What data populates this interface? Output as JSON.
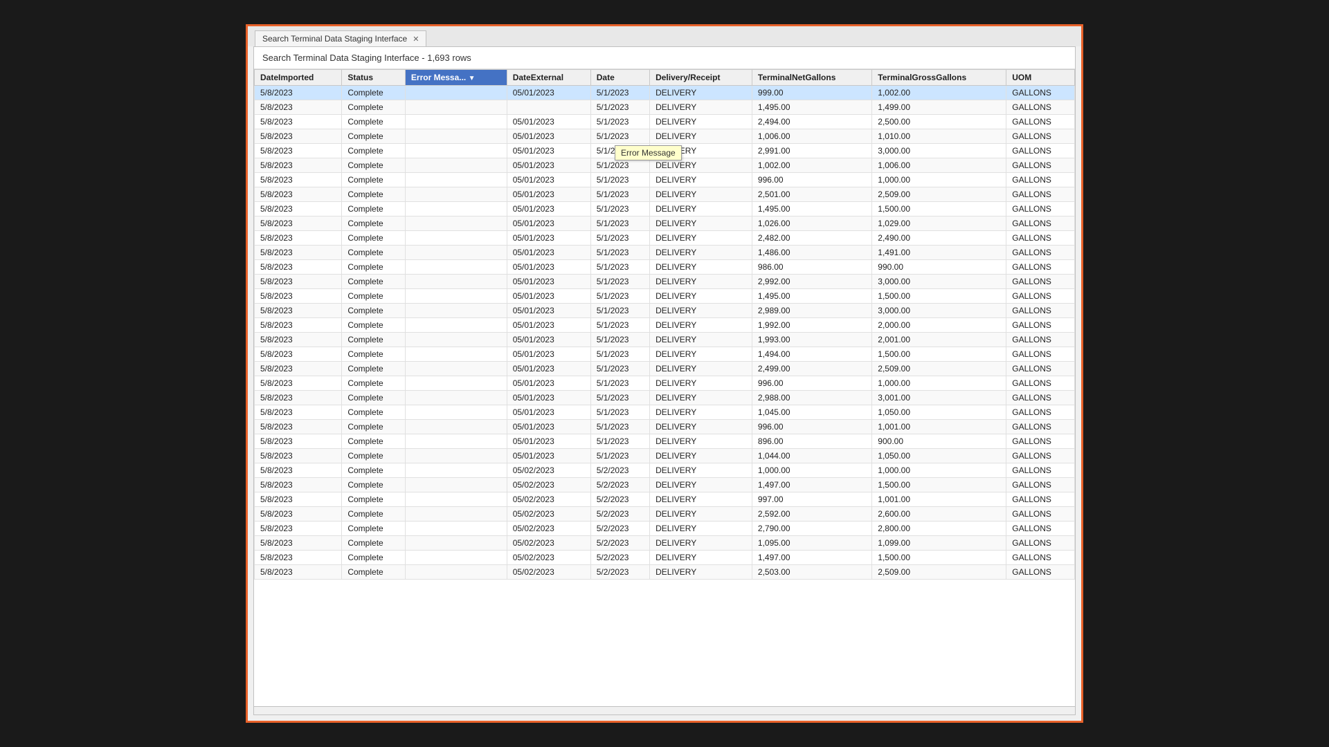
{
  "window": {
    "tab_label": "Search Terminal Data Staging Interface",
    "title": "Search Terminal Data Staging Interface - 1,693 rows",
    "tooltip": "Error Message"
  },
  "columns": [
    {
      "key": "dateImported",
      "label": "DateImported",
      "filter": false
    },
    {
      "key": "status",
      "label": "Status",
      "filter": false
    },
    {
      "key": "errorMessage",
      "label": "Error Messa...",
      "filter": true
    },
    {
      "key": "dateExternal",
      "label": "DateExternal",
      "filter": false
    },
    {
      "key": "date",
      "label": "Date",
      "filter": false
    },
    {
      "key": "deliveryReceipt",
      "label": "Delivery/Receipt",
      "filter": false
    },
    {
      "key": "terminalNetGallons",
      "label": "TerminalNetGallons",
      "filter": false
    },
    {
      "key": "terminalGrossGallons",
      "label": "TerminalGrossGallons",
      "filter": false
    },
    {
      "key": "uom",
      "label": "UOM",
      "filter": false
    }
  ],
  "rows": [
    {
      "dateImported": "5/8/2023",
      "status": "Complete",
      "errorMessage": "",
      "dateExternal": "05/01/2023",
      "date": "5/1/2023",
      "deliveryReceipt": "DELIVERY",
      "terminalNetGallons": "999.00",
      "terminalGrossGallons": "1,002.00",
      "uom": "GALLONS",
      "selected": true
    },
    {
      "dateImported": "5/8/2023",
      "status": "Complete",
      "errorMessage": "",
      "dateExternal": "",
      "date": "5/1/2023",
      "deliveryReceipt": "DELIVERY",
      "terminalNetGallons": "1,495.00",
      "terminalGrossGallons": "1,499.00",
      "uom": "GALLONS",
      "selected": false
    },
    {
      "dateImported": "5/8/2023",
      "status": "Complete",
      "errorMessage": "",
      "dateExternal": "05/01/2023",
      "date": "5/1/2023",
      "deliveryReceipt": "DELIVERY",
      "terminalNetGallons": "2,494.00",
      "terminalGrossGallons": "2,500.00",
      "uom": "GALLONS",
      "selected": false
    },
    {
      "dateImported": "5/8/2023",
      "status": "Complete",
      "errorMessage": "",
      "dateExternal": "05/01/2023",
      "date": "5/1/2023",
      "deliveryReceipt": "DELIVERY",
      "terminalNetGallons": "1,006.00",
      "terminalGrossGallons": "1,010.00",
      "uom": "GALLONS",
      "selected": false
    },
    {
      "dateImported": "5/8/2023",
      "status": "Complete",
      "errorMessage": "",
      "dateExternal": "05/01/2023",
      "date": "5/1/2023",
      "deliveryReceipt": "DELIVERY",
      "terminalNetGallons": "2,991.00",
      "terminalGrossGallons": "3,000.00",
      "uom": "GALLONS",
      "selected": false
    },
    {
      "dateImported": "5/8/2023",
      "status": "Complete",
      "errorMessage": "",
      "dateExternal": "05/01/2023",
      "date": "5/1/2023",
      "deliveryReceipt": "DELIVERY",
      "terminalNetGallons": "1,002.00",
      "terminalGrossGallons": "1,006.00",
      "uom": "GALLONS",
      "selected": false
    },
    {
      "dateImported": "5/8/2023",
      "status": "Complete",
      "errorMessage": "",
      "dateExternal": "05/01/2023",
      "date": "5/1/2023",
      "deliveryReceipt": "DELIVERY",
      "terminalNetGallons": "996.00",
      "terminalGrossGallons": "1,000.00",
      "uom": "GALLONS",
      "selected": false
    },
    {
      "dateImported": "5/8/2023",
      "status": "Complete",
      "errorMessage": "",
      "dateExternal": "05/01/2023",
      "date": "5/1/2023",
      "deliveryReceipt": "DELIVERY",
      "terminalNetGallons": "2,501.00",
      "terminalGrossGallons": "2,509.00",
      "uom": "GALLONS",
      "selected": false
    },
    {
      "dateImported": "5/8/2023",
      "status": "Complete",
      "errorMessage": "",
      "dateExternal": "05/01/2023",
      "date": "5/1/2023",
      "deliveryReceipt": "DELIVERY",
      "terminalNetGallons": "1,495.00",
      "terminalGrossGallons": "1,500.00",
      "uom": "GALLONS",
      "selected": false
    },
    {
      "dateImported": "5/8/2023",
      "status": "Complete",
      "errorMessage": "",
      "dateExternal": "05/01/2023",
      "date": "5/1/2023",
      "deliveryReceipt": "DELIVERY",
      "terminalNetGallons": "1,026.00",
      "terminalGrossGallons": "1,029.00",
      "uom": "GALLONS",
      "selected": false
    },
    {
      "dateImported": "5/8/2023",
      "status": "Complete",
      "errorMessage": "",
      "dateExternal": "05/01/2023",
      "date": "5/1/2023",
      "deliveryReceipt": "DELIVERY",
      "terminalNetGallons": "2,482.00",
      "terminalGrossGallons": "2,490.00",
      "uom": "GALLONS",
      "selected": false
    },
    {
      "dateImported": "5/8/2023",
      "status": "Complete",
      "errorMessage": "",
      "dateExternal": "05/01/2023",
      "date": "5/1/2023",
      "deliveryReceipt": "DELIVERY",
      "terminalNetGallons": "1,486.00",
      "terminalGrossGallons": "1,491.00",
      "uom": "GALLONS",
      "selected": false
    },
    {
      "dateImported": "5/8/2023",
      "status": "Complete",
      "errorMessage": "",
      "dateExternal": "05/01/2023",
      "date": "5/1/2023",
      "deliveryReceipt": "DELIVERY",
      "terminalNetGallons": "986.00",
      "terminalGrossGallons": "990.00",
      "uom": "GALLONS",
      "selected": false
    },
    {
      "dateImported": "5/8/2023",
      "status": "Complete",
      "errorMessage": "",
      "dateExternal": "05/01/2023",
      "date": "5/1/2023",
      "deliveryReceipt": "DELIVERY",
      "terminalNetGallons": "2,992.00",
      "terminalGrossGallons": "3,000.00",
      "uom": "GALLONS",
      "selected": false
    },
    {
      "dateImported": "5/8/2023",
      "status": "Complete",
      "errorMessage": "",
      "dateExternal": "05/01/2023",
      "date": "5/1/2023",
      "deliveryReceipt": "DELIVERY",
      "terminalNetGallons": "1,495.00",
      "terminalGrossGallons": "1,500.00",
      "uom": "GALLONS",
      "selected": false
    },
    {
      "dateImported": "5/8/2023",
      "status": "Complete",
      "errorMessage": "",
      "dateExternal": "05/01/2023",
      "date": "5/1/2023",
      "deliveryReceipt": "DELIVERY",
      "terminalNetGallons": "2,989.00",
      "terminalGrossGallons": "3,000.00",
      "uom": "GALLONS",
      "selected": false
    },
    {
      "dateImported": "5/8/2023",
      "status": "Complete",
      "errorMessage": "",
      "dateExternal": "05/01/2023",
      "date": "5/1/2023",
      "deliveryReceipt": "DELIVERY",
      "terminalNetGallons": "1,992.00",
      "terminalGrossGallons": "2,000.00",
      "uom": "GALLONS",
      "selected": false
    },
    {
      "dateImported": "5/8/2023",
      "status": "Complete",
      "errorMessage": "",
      "dateExternal": "05/01/2023",
      "date": "5/1/2023",
      "deliveryReceipt": "DELIVERY",
      "terminalNetGallons": "1,993.00",
      "terminalGrossGallons": "2,001.00",
      "uom": "GALLONS",
      "selected": false
    },
    {
      "dateImported": "5/8/2023",
      "status": "Complete",
      "errorMessage": "",
      "dateExternal": "05/01/2023",
      "date": "5/1/2023",
      "deliveryReceipt": "DELIVERY",
      "terminalNetGallons": "1,494.00",
      "terminalGrossGallons": "1,500.00",
      "uom": "GALLONS",
      "selected": false
    },
    {
      "dateImported": "5/8/2023",
      "status": "Complete",
      "errorMessage": "",
      "dateExternal": "05/01/2023",
      "date": "5/1/2023",
      "deliveryReceipt": "DELIVERY",
      "terminalNetGallons": "2,499.00",
      "terminalGrossGallons": "2,509.00",
      "uom": "GALLONS",
      "selected": false
    },
    {
      "dateImported": "5/8/2023",
      "status": "Complete",
      "errorMessage": "",
      "dateExternal": "05/01/2023",
      "date": "5/1/2023",
      "deliveryReceipt": "DELIVERY",
      "terminalNetGallons": "996.00",
      "terminalGrossGallons": "1,000.00",
      "uom": "GALLONS",
      "selected": false
    },
    {
      "dateImported": "5/8/2023",
      "status": "Complete",
      "errorMessage": "",
      "dateExternal": "05/01/2023",
      "date": "5/1/2023",
      "deliveryReceipt": "DELIVERY",
      "terminalNetGallons": "2,988.00",
      "terminalGrossGallons": "3,001.00",
      "uom": "GALLONS",
      "selected": false
    },
    {
      "dateImported": "5/8/2023",
      "status": "Complete",
      "errorMessage": "",
      "dateExternal": "05/01/2023",
      "date": "5/1/2023",
      "deliveryReceipt": "DELIVERY",
      "terminalNetGallons": "1,045.00",
      "terminalGrossGallons": "1,050.00",
      "uom": "GALLONS",
      "selected": false
    },
    {
      "dateImported": "5/8/2023",
      "status": "Complete",
      "errorMessage": "",
      "dateExternal": "05/01/2023",
      "date": "5/1/2023",
      "deliveryReceipt": "DELIVERY",
      "terminalNetGallons": "996.00",
      "terminalGrossGallons": "1,001.00",
      "uom": "GALLONS",
      "selected": false
    },
    {
      "dateImported": "5/8/2023",
      "status": "Complete",
      "errorMessage": "",
      "dateExternal": "05/01/2023",
      "date": "5/1/2023",
      "deliveryReceipt": "DELIVERY",
      "terminalNetGallons": "896.00",
      "terminalGrossGallons": "900.00",
      "uom": "GALLONS",
      "selected": false
    },
    {
      "dateImported": "5/8/2023",
      "status": "Complete",
      "errorMessage": "",
      "dateExternal": "05/01/2023",
      "date": "5/1/2023",
      "deliveryReceipt": "DELIVERY",
      "terminalNetGallons": "1,044.00",
      "terminalGrossGallons": "1,050.00",
      "uom": "GALLONS",
      "selected": false
    },
    {
      "dateImported": "5/8/2023",
      "status": "Complete",
      "errorMessage": "",
      "dateExternal": "05/02/2023",
      "date": "5/2/2023",
      "deliveryReceipt": "DELIVERY",
      "terminalNetGallons": "1,000.00",
      "terminalGrossGallons": "1,000.00",
      "uom": "GALLONS",
      "selected": false
    },
    {
      "dateImported": "5/8/2023",
      "status": "Complete",
      "errorMessage": "",
      "dateExternal": "05/02/2023",
      "date": "5/2/2023",
      "deliveryReceipt": "DELIVERY",
      "terminalNetGallons": "1,497.00",
      "terminalGrossGallons": "1,500.00",
      "uom": "GALLONS",
      "selected": false
    },
    {
      "dateImported": "5/8/2023",
      "status": "Complete",
      "errorMessage": "",
      "dateExternal": "05/02/2023",
      "date": "5/2/2023",
      "deliveryReceipt": "DELIVERY",
      "terminalNetGallons": "997.00",
      "terminalGrossGallons": "1,001.00",
      "uom": "GALLONS",
      "selected": false
    },
    {
      "dateImported": "5/8/2023",
      "status": "Complete",
      "errorMessage": "",
      "dateExternal": "05/02/2023",
      "date": "5/2/2023",
      "deliveryReceipt": "DELIVERY",
      "terminalNetGallons": "2,592.00",
      "terminalGrossGallons": "2,600.00",
      "uom": "GALLONS",
      "selected": false
    },
    {
      "dateImported": "5/8/2023",
      "status": "Complete",
      "errorMessage": "",
      "dateExternal": "05/02/2023",
      "date": "5/2/2023",
      "deliveryReceipt": "DELIVERY",
      "terminalNetGallons": "2,790.00",
      "terminalGrossGallons": "2,800.00",
      "uom": "GALLONS",
      "selected": false
    },
    {
      "dateImported": "5/8/2023",
      "status": "Complete",
      "errorMessage": "",
      "dateExternal": "05/02/2023",
      "date": "5/2/2023",
      "deliveryReceipt": "DELIVERY",
      "terminalNetGallons": "1,095.00",
      "terminalGrossGallons": "1,099.00",
      "uom": "GALLONS",
      "selected": false
    },
    {
      "dateImported": "5/8/2023",
      "status": "Complete",
      "errorMessage": "",
      "dateExternal": "05/02/2023",
      "date": "5/2/2023",
      "deliveryReceipt": "DELIVERY",
      "terminalNetGallons": "1,497.00",
      "terminalGrossGallons": "1,500.00",
      "uom": "GALLONS",
      "selected": false
    },
    {
      "dateImported": "5/8/2023",
      "status": "Complete",
      "errorMessage": "",
      "dateExternal": "05/02/2023",
      "date": "5/2/2023",
      "deliveryReceipt": "DELIVERY",
      "terminalNetGallons": "2,503.00",
      "terminalGrossGallons": "2,509.00",
      "uom": "GALLONS",
      "selected": false
    }
  ]
}
